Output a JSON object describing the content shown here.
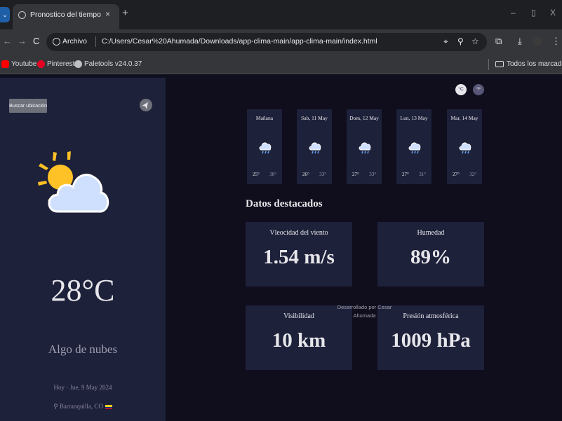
{
  "browser": {
    "tab_title": "Pronostico del tiempo",
    "tab_close": "×",
    "new_tab": "+",
    "window_controls": [
      "–",
      "▯",
      "X"
    ],
    "nav": {
      "back": "←",
      "forward": "→",
      "reload": "C"
    },
    "address": {
      "scheme_label": "Archivo",
      "url": "C:/Users/Cesar%20Ahumada/Downloads/app-clima-main/app-clima-main/index.html"
    },
    "bookmarks": [
      {
        "label": "Youtube",
        "icon": "youtube-icon",
        "color": "#ff0000"
      },
      {
        "label": "Pinterest",
        "icon": "pinterest-icon",
        "color": "#e60023"
      },
      {
        "label": "Paletools v24.0.37",
        "icon": "globe-icon",
        "color": "#bdc1c6"
      }
    ],
    "all_bookmarks": "Todos los marcadores"
  },
  "sidebar": {
    "search_button": "Buscar ubicación",
    "current_icon": "sun-cloud-icon",
    "temperature": "28°C",
    "description": "Algo de nubes",
    "date": "Hoy · Jue, 9 May 2024",
    "location": "Barranquilla, CO"
  },
  "units": {
    "celsius": "°C",
    "fahrenheit": "°F"
  },
  "forecast": [
    {
      "day": "Mañana",
      "icon": "rain-cloud-icon",
      "max": "25°",
      "min": "30°"
    },
    {
      "day": "Sab, 11 May",
      "icon": "rain-cloud-icon",
      "max": "26°",
      "min": "33°"
    },
    {
      "day": "Dom, 12 May",
      "icon": "rain-cloud-icon",
      "max": "27°",
      "min": "33°"
    },
    {
      "day": "Lun, 13 May",
      "icon": "rain-cloud-icon",
      "max": "27°",
      "min": "31°"
    },
    {
      "day": "Mar, 14 May",
      "icon": "rain-cloud-icon",
      "max": "27°",
      "min": "32°"
    }
  ],
  "highlights": {
    "title": "Datos destacados",
    "wind": {
      "label": "Vleocidad del viento",
      "value": "1.54 m/s"
    },
    "humidity": {
      "label": "Humedad",
      "value": "89%"
    },
    "visibility": {
      "label": "Visibilidad",
      "value": "10 km"
    },
    "pressure": {
      "label": "Presión atmosférica",
      "value": "1009 hPa"
    }
  },
  "footer": "Desarrollado por Cesar Ahumada",
  "colors": {
    "sidebar_bg": "#1e213a",
    "main_bg": "#100e1d",
    "card_bg": "#1e213a",
    "sun": "#ffc226",
    "cloud": "#cfe0ff"
  }
}
